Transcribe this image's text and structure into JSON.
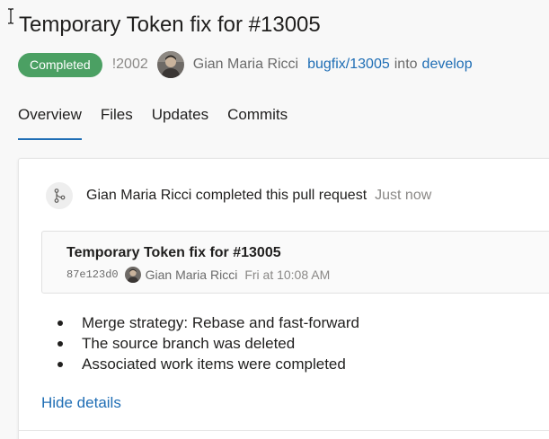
{
  "header": {
    "title": "Temporary Token fix for #13005",
    "status": "Completed",
    "pr_id": "!2002",
    "author": "Gian Maria Ricci",
    "source_branch": "bugfix/13005",
    "into_text": "into",
    "target_branch": "develop"
  },
  "tabs": [
    {
      "label": "Overview"
    },
    {
      "label": "Files"
    },
    {
      "label": "Updates"
    },
    {
      "label": "Commits"
    }
  ],
  "activity": {
    "text": "Gian Maria Ricci completed this pull request",
    "time": "Just now",
    "commit": {
      "title": "Temporary Token fix for #13005",
      "sha": "87e123d0",
      "author": "Gian Maria Ricci",
      "time": "Fri at 10:08 AM"
    },
    "details": [
      "Merge strategy: Rebase and fast-forward",
      "The source branch was deleted",
      "Associated work items were completed"
    ],
    "hide_details": "Hide details"
  },
  "colors": {
    "accent": "#1f6eb5",
    "completed_badge": "#4ba063",
    "page_background": "#f8f8f8"
  },
  "icons": [
    "text-cursor-icon",
    "avatar",
    "merge-icon"
  ]
}
